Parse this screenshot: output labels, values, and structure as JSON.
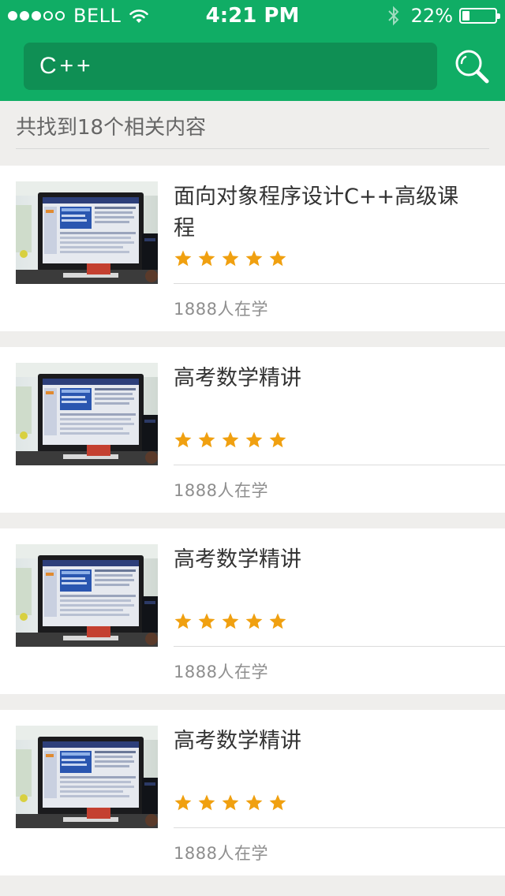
{
  "status_bar": {
    "carrier": "BELL",
    "time": "4:21 PM",
    "battery": "22%",
    "battery_level": 0.22,
    "signal_bars_filled": 3,
    "signal_bars_total": 5
  },
  "search": {
    "query": "C++",
    "icon": "search-icon"
  },
  "results": {
    "summary": "共找到18个相关内容",
    "items": [
      {
        "title": "面向对象程序设计C++高级课程",
        "rating": 5,
        "learners": "1888人在学"
      },
      {
        "title": "高考数学精讲",
        "rating": 5,
        "learners": "1888人在学"
      },
      {
        "title": "高考数学精讲",
        "rating": 5,
        "learners": "1888人在学"
      },
      {
        "title": "高考数学精讲",
        "rating": 5,
        "learners": "1888人在学"
      }
    ]
  },
  "colors": {
    "brand_green": "#10ad65",
    "search_bg": "#0f8f54",
    "star": "#f0a010"
  }
}
